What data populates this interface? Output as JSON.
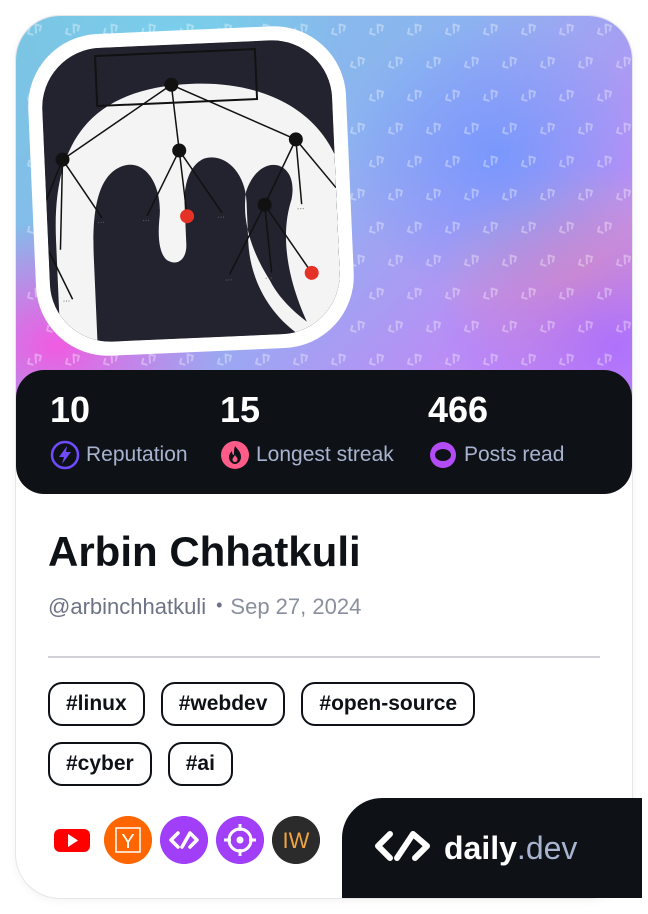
{
  "profile": {
    "name": "Arbin Chhatkuli",
    "handle": "@arbinchhatkuli",
    "separator": "•",
    "joined": "Sep 27, 2024"
  },
  "stats": [
    {
      "value": "10",
      "label": "Reputation",
      "icon": "lightning-icon",
      "color": "#6f4bff"
    },
    {
      "value": "15",
      "label": "Longest streak",
      "icon": "flame-icon",
      "color": "#ff5c8a"
    },
    {
      "value": "466",
      "label": "Posts read",
      "icon": "eye-icon",
      "color": "#b44cf6"
    }
  ],
  "tags": [
    "#linux",
    "#webdev",
    "#open-source",
    "#cyber",
    "#ai"
  ],
  "sources": [
    {
      "name": "youtube-icon",
      "color": "#ff0000"
    },
    {
      "name": "hacker-news-icon",
      "letter": "Y",
      "color": "#ff6600"
    },
    {
      "name": "daily-dev-squad-icon",
      "color": "#a13ff8"
    },
    {
      "name": "target-squad-icon",
      "color": "#a13ff8"
    },
    {
      "name": "iw-source-icon",
      "letter": "IW",
      "color": "#2b2b2b"
    }
  ],
  "brand": {
    "name": "daily",
    "suffix": ".dev"
  },
  "colors": {
    "dark": "#0e1217",
    "muted": "#a8b3cf",
    "accent": "#6f4bff"
  }
}
